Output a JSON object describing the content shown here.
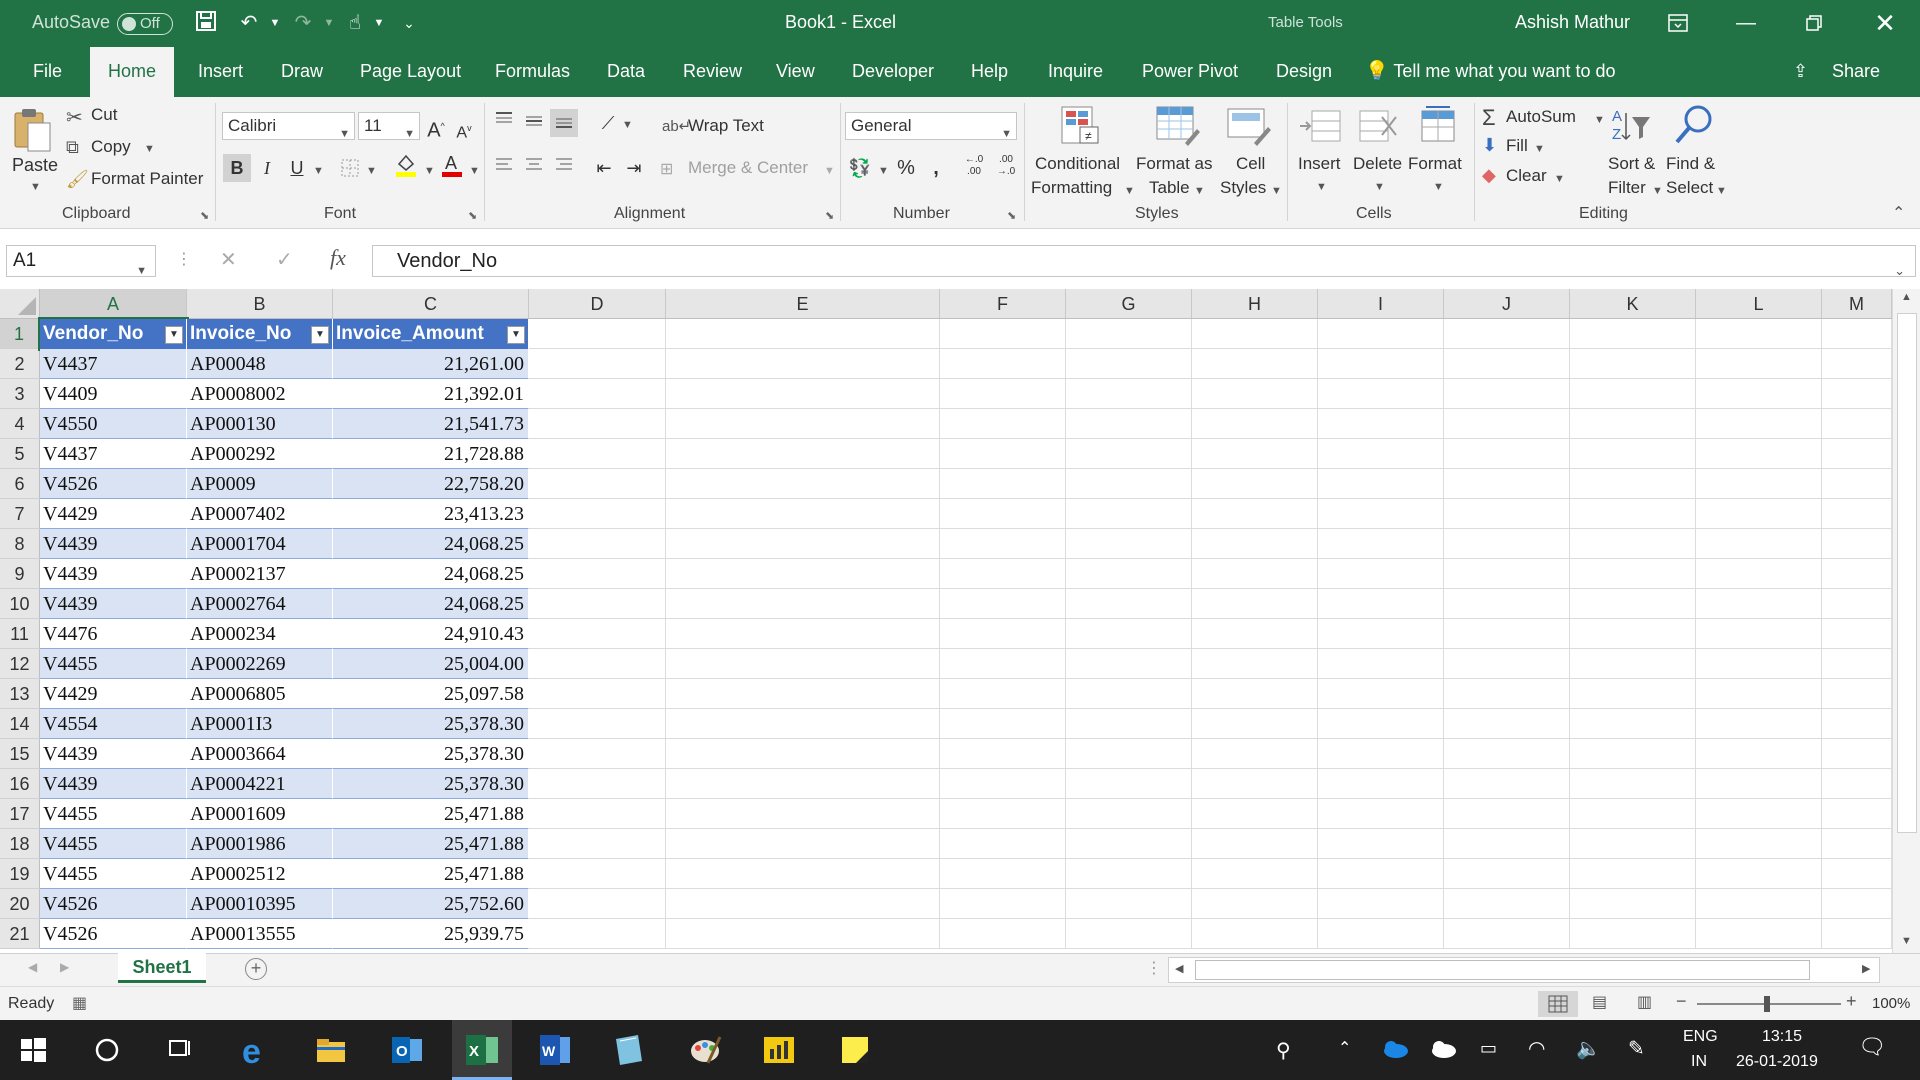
{
  "titlebar": {
    "autosave_label": "AutoSave",
    "autosave_state": "Off",
    "title": "Book1  -  Excel",
    "context_tab": "Table Tools",
    "user": "Ashish Mathur"
  },
  "tabs": [
    "File",
    "Home",
    "Insert",
    "Draw",
    "Page Layout",
    "Formulas",
    "Data",
    "Review",
    "View",
    "Developer",
    "Help",
    "Inquire",
    "Power Pivot",
    "Design"
  ],
  "active_tab": "Home",
  "tell_me": "Tell me what you want to do",
  "share": "Share",
  "ribbon": {
    "clipboard": {
      "paste": "Paste",
      "cut": "Cut",
      "copy": "Copy",
      "format_painter": "Format Painter",
      "label": "Clipboard"
    },
    "font": {
      "name": "Calibri",
      "size": "11",
      "label": "Font"
    },
    "alignment": {
      "wrap_text": "Wrap Text",
      "merge_center": "Merge & Center",
      "label": "Alignment"
    },
    "number": {
      "format": "General",
      "label": "Number"
    },
    "styles": {
      "conditional": [
        "Conditional",
        "Formatting"
      ],
      "format_table": [
        "Format as",
        "Table"
      ],
      "cell_styles": [
        "Cell",
        "Styles"
      ],
      "label": "Styles"
    },
    "cells": {
      "insert": "Insert",
      "delete": "Delete",
      "format": "Format",
      "label": "Cells"
    },
    "editing": {
      "autosum": "AutoSum",
      "fill": "Fill",
      "clear": "Clear",
      "sort_filter": [
        "Sort &",
        "Filter"
      ],
      "find_select": [
        "Find &",
        "Select"
      ],
      "label": "Editing"
    }
  },
  "formula_bar": {
    "name_box": "A1",
    "fx": "fx",
    "content": "Vendor_No"
  },
  "columns": [
    "A",
    "B",
    "C",
    "D",
    "E",
    "F",
    "G",
    "H",
    "I",
    "J",
    "K",
    "L",
    "M"
  ],
  "table": {
    "headers": [
      "Vendor_No",
      "Invoice_No",
      "Invoice_Amount"
    ],
    "rows": [
      [
        "V4437",
        "AP00048",
        "21,261.00"
      ],
      [
        "V4409",
        "AP0008002",
        "21,392.01"
      ],
      [
        "V4550",
        "AP000130",
        "21,541.73"
      ],
      [
        "V4437",
        "AP000292",
        "21,728.88"
      ],
      [
        "V4526",
        "AP0009",
        "22,758.20"
      ],
      [
        "V4429",
        "AP0007402",
        "23,413.23"
      ],
      [
        "V4439",
        "AP0001704",
        "24,068.25"
      ],
      [
        "V4439",
        "AP0002137",
        "24,068.25"
      ],
      [
        "V4439",
        "AP0002764",
        "24,068.25"
      ],
      [
        "V4476",
        "AP000234",
        "24,910.43"
      ],
      [
        "V4455",
        "AP0002269",
        "25,004.00"
      ],
      [
        "V4429",
        "AP0006805",
        "25,097.58"
      ],
      [
        "V4554",
        "AP0001I3",
        "25,378.30"
      ],
      [
        "V4439",
        "AP0003664",
        "25,378.30"
      ],
      [
        "V4439",
        "AP0004221",
        "25,378.30"
      ],
      [
        "V4455",
        "AP0001609",
        "25,471.88"
      ],
      [
        "V4455",
        "AP0001986",
        "25,471.88"
      ],
      [
        "V4455",
        "AP0002512",
        "25,471.88"
      ],
      [
        "V4526",
        "AP00010395",
        "25,752.60"
      ],
      [
        "V4526",
        "AP00013555",
        "25,939.75"
      ]
    ]
  },
  "sheet_tab": "Sheet1",
  "status": {
    "ready": "Ready",
    "zoom": "100%"
  },
  "taskbar": {
    "lang": [
      "ENG",
      "IN"
    ],
    "time": "13:15",
    "date": "26-01-2019"
  },
  "colors": {
    "excel_green": "#217346",
    "table_header": "#4472c4",
    "table_band": "#dae3f3"
  }
}
